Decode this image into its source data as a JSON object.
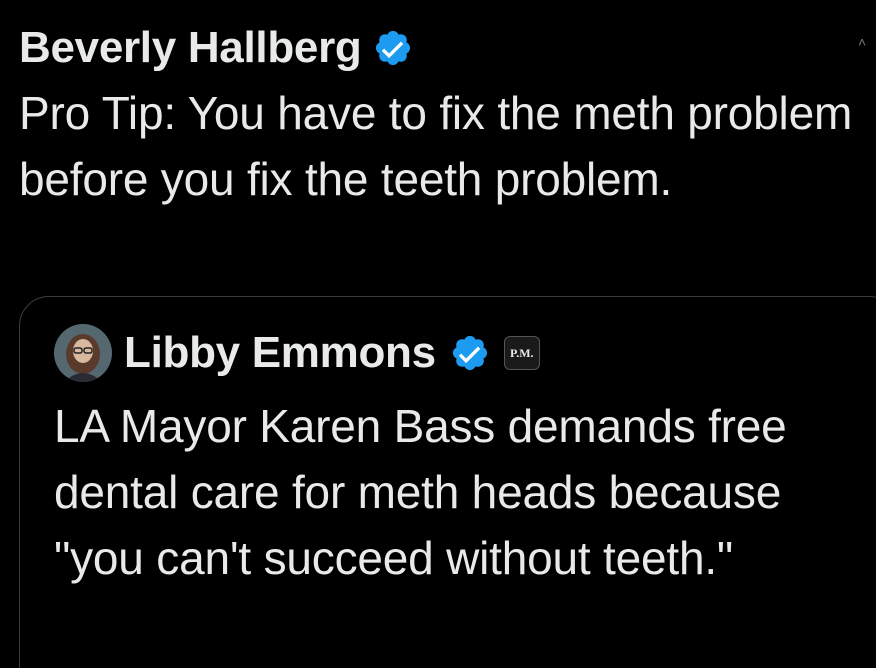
{
  "post": {
    "author_name": "Beverly Hallberg",
    "verified_icon": "verified-badge-icon",
    "text": "Pro Tip: You have to fix the meth problem before you fix the teeth problem."
  },
  "quoted_post": {
    "author_name": "Libby Emmons",
    "verified_icon": "verified-badge-icon",
    "affiliate_badge_label": "P.M.",
    "text": "LA Mayor Karen Bass demands free dental care for meth heads because \"you can't succeed without teeth.\""
  },
  "colors": {
    "background": "#000000",
    "text_primary": "#e7e9ea",
    "verified_blue": "#1d9bf0",
    "border": "#3a3d40"
  }
}
